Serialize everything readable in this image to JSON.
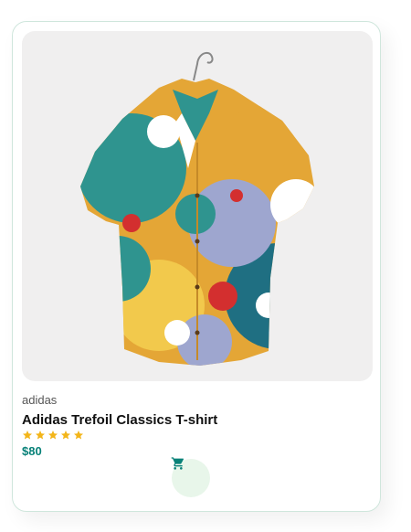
{
  "product": {
    "brand": "adidas",
    "name": "Adidas Trefoil Classics T-shirt",
    "rating": 5,
    "rating_max": 5,
    "price": "$80",
    "image": "hawaiian-print-shirt-on-hanger"
  },
  "icons": {
    "star": "star-icon",
    "cart": "shopping-cart-icon"
  },
  "colors": {
    "accent": "#088178",
    "star": "#f3b519",
    "cart_bg": "#e8f6ea",
    "card_border": "#cfe6dc"
  }
}
